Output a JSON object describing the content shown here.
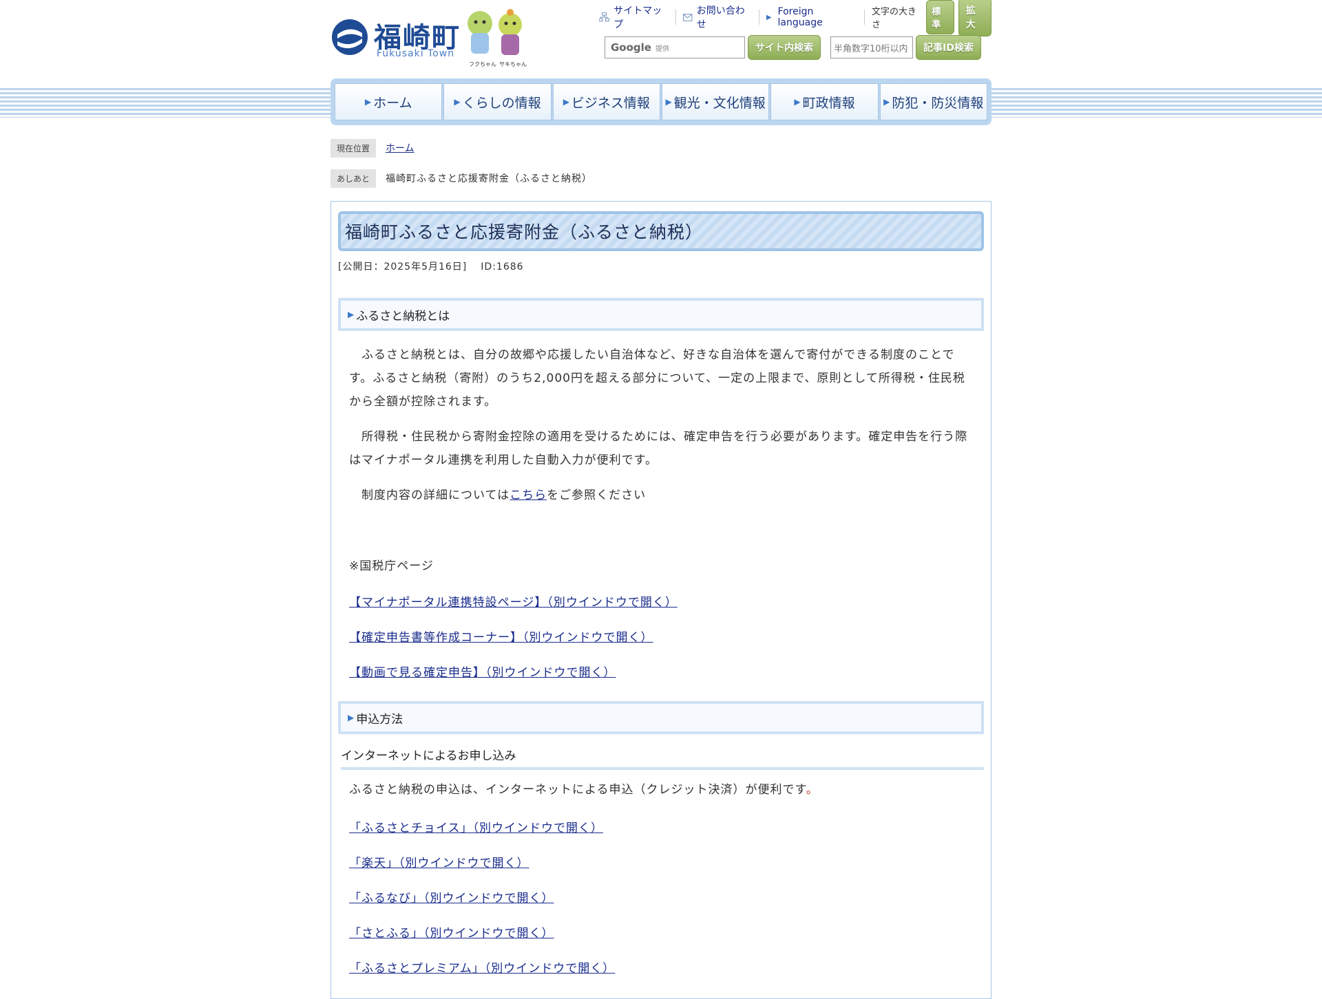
{
  "header": {
    "logo_text": "福崎町",
    "logo_sub": "Fukusaki Town",
    "mascot_left": "フクちゃん",
    "mascot_right": "サキちゃん",
    "utility": {
      "sitemap": "サイトマップ",
      "contact": "お問い合わせ",
      "foreign": "Foreign language",
      "font_size_label": "文字の大きさ",
      "font_standard": "標準",
      "font_large": "拡大"
    },
    "search": {
      "google_label": "Google",
      "google_sub": "提供",
      "site_search_button": "サイト内検索",
      "id_placeholder": "半角数字10桁以内",
      "id_search_button": "記事ID検索"
    }
  },
  "nav": [
    "ホーム",
    "くらしの情報",
    "ビジネス情報",
    "観光・文化情報",
    "町政情報",
    "防犯・防災情報"
  ],
  "breadcrumb": {
    "current_label": "現在位置",
    "current_link": "ホーム",
    "history_label": "あしあと",
    "history_text": "福崎町ふるさと応援寄附金（ふるさと納税）"
  },
  "article": {
    "title": "福崎町ふるさと応援寄附金（ふるさと納税）",
    "published": "[公開日：2025年5月16日]",
    "id": "ID:1686",
    "section1": {
      "heading": "ふるさと納税とは",
      "para1": "　ふるさと納税とは、自分の故郷や応援したい自治体など、好きな自治体を選んで寄付ができる制度のことです。ふるさと納税（寄附）のうち2,000円を超える部分について、一定の上限まで、原則として所得税・住民税から全額が控除されます。",
      "para2": "　所得税・住民税から寄附金控除の適用を受けるためには、確定申告を行う必要があります。確定申告を行う際はマイナポータル連携を利用した自動入力が便利です。",
      "para3_before": "　制度内容の詳細については",
      "para3_link": "こちら",
      "para3_after": "をご参照ください",
      "note": "※国税庁ページ",
      "links": [
        "【マイナポータル連携特設ページ】（別ウインドウで開く）",
        "【確定申告書等作成コーナー】（別ウインドウで開く）",
        "【動画で見る確定申告】（別ウインドウで開く）"
      ]
    },
    "section2": {
      "heading": "申込方法",
      "subheading": "インターネットによるお申し込み",
      "para": "ふるさと納税の申込は、インターネットによる申込（クレジット決済）が便利です",
      "para_end": "。",
      "links": [
        "「ふるさとチョイス」（別ウインドウで開く）",
        "「楽天」（別ウインドウで開く）",
        "「ふるなび」（別ウインドウで開く）",
        "「さとふる」（別ウインドウで開く）",
        "「ふるさとプレミアム」（別ウインドウで開く）"
      ]
    }
  },
  "colors": {
    "brand_blue": "#1f4b94",
    "nav_border": "#a9c5e3",
    "green_button": "#8fae55",
    "link": "#1a2c8c"
  }
}
